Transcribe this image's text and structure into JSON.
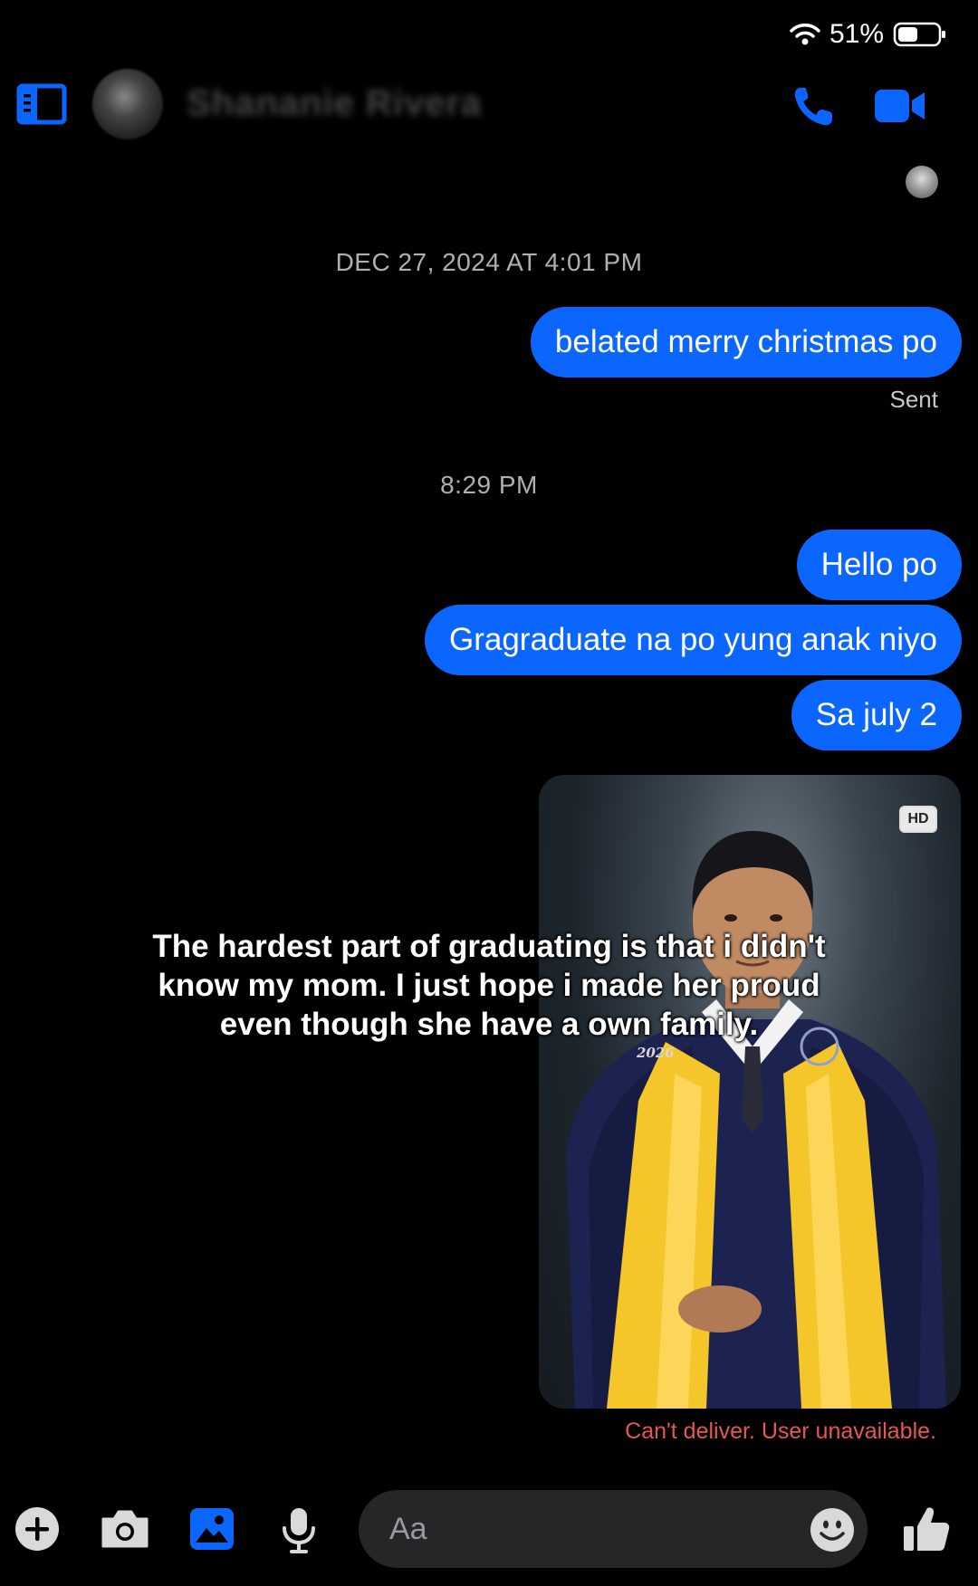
{
  "status_bar": {
    "battery_percent": "51%",
    "icons": [
      "wifi-icon",
      "battery-icon"
    ]
  },
  "header": {
    "contact_name": "Shananie Rivera",
    "icons": [
      "sidebar-icon",
      "phone-icon",
      "video-call-icon"
    ]
  },
  "conversation": {
    "timestamp_1": "DEC 27, 2024 AT 4:01 PM",
    "message_1": "belated merry christmas po",
    "sent_label": "Sent",
    "timestamp_2": "8:29 PM",
    "message_2": "Hello po",
    "message_3": "Gragraduate na po yung anak niyo",
    "message_4": "Sa july 2",
    "photo": {
      "badge": "HD",
      "year_text": "2026"
    },
    "caption_overlay": "The hardest part of graduating is that i didn't\nknow my mom. I just hope i made her proud\neven though she have a own family.",
    "error_text": "Can't deliver. User unavailable."
  },
  "composer": {
    "placeholder": "Aa",
    "icons": [
      "plus-icon",
      "camera-icon",
      "gallery-icon",
      "microphone-icon",
      "emoji-icon",
      "thumbs-up-icon"
    ]
  },
  "colors": {
    "accent": "#0a66ff",
    "background": "#000000",
    "error": "#e8574f",
    "timestamp": "#b0b0b0"
  }
}
